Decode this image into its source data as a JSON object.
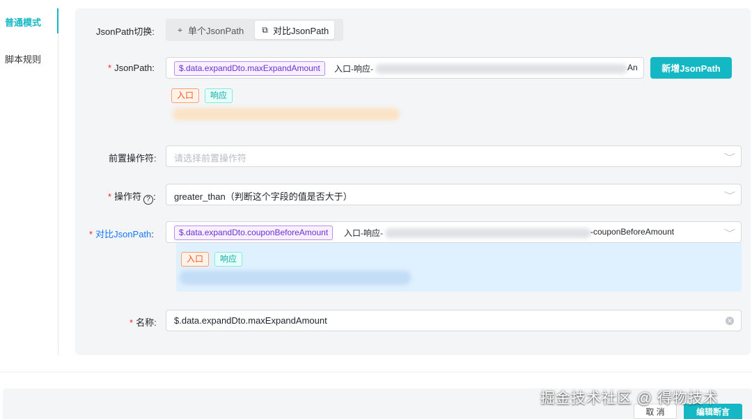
{
  "sidebar": {
    "items": [
      {
        "label": "普通模式"
      },
      {
        "label": "脚本规则"
      }
    ]
  },
  "form": {
    "jsonpath_switch": {
      "label": "JsonPath切换",
      "colon": ":",
      "options": [
        "单个JsonPath",
        "对比JsonPath"
      ],
      "selected": "对比JsonPath"
    },
    "jsonpath": {
      "required_mark": "*",
      "label": "JsonPath",
      "colon": ":",
      "tag": "$.data.expandDto.maxExpandAmount",
      "prefix_text": "入口-响应-",
      "suffix_text": "An",
      "add_button": "新增JsonPath",
      "tag_entry": "入口",
      "tag_response": "响应"
    },
    "pre_operator": {
      "label": "前置操作符",
      "colon": ":",
      "placeholder": "请选择前置操作符"
    },
    "operator": {
      "required_mark": "*",
      "label": "操作符",
      "help_glyph": "?",
      "colon": ":",
      "value": "greater_than（判断这个字段的值是否大于）"
    },
    "compare_jsonpath": {
      "required_mark": "*",
      "label": "对比JsonPath",
      "colon": ":",
      "tag": "$.data.expandDto.couponBeforeAmount",
      "prefix_text": "入口-响应-",
      "suffix_text": "-couponBeforeAmount",
      "tag_entry": "入口",
      "tag_response": "响应"
    },
    "name": {
      "required_mark": "*",
      "label": "名称",
      "colon": ":",
      "value": "$.data.expandDto.maxExpandAmount"
    }
  },
  "footer": {
    "cancel": "取 消",
    "edit": "编辑断言",
    "watermark": "掘金技术社区 @ 得物技术"
  },
  "colors": {
    "accent": "#13b8c4",
    "panel_bg": "#f4f5f6",
    "compare_bg": "#dff0fe",
    "required": "#f5222d"
  },
  "icons": {
    "single": "crosshair-icon",
    "compare": "copy-icon",
    "chevron": "chevron-down-icon",
    "clear": "clear-circle-icon",
    "help": "question-circle-icon"
  }
}
